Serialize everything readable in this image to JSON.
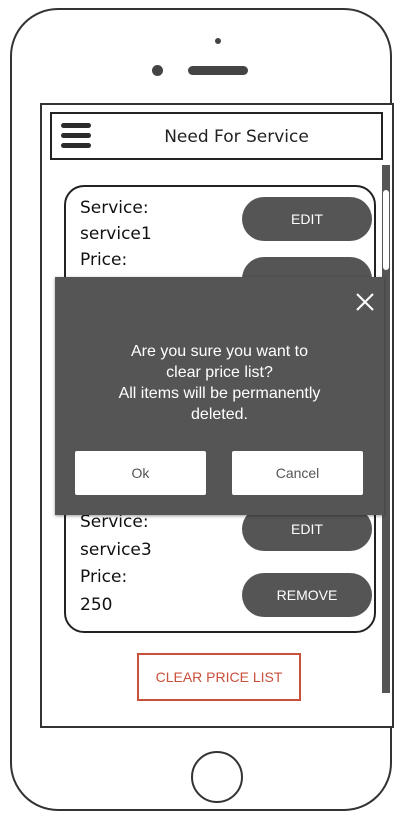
{
  "header": {
    "title": "Need For Service"
  },
  "cards": [
    {
      "service_label": "Service:",
      "service_value": "service1",
      "price_label": "Price:",
      "edit_label": "EDIT"
    },
    {
      "service_label": "Service:",
      "service_value": "service3",
      "price_label": "Price:",
      "price_value": "250",
      "edit_label": "EDIT",
      "remove_label": "REMOVE"
    }
  ],
  "clear_button": "CLEAR PRICE LIST",
  "dialog": {
    "message_line1": "Are you sure you want to",
    "message_line2": "clear price list?",
    "message_line3": "All items will be permanently",
    "message_line4": "deleted.",
    "ok_label": "Ok",
    "cancel_label": "Cancel"
  },
  "colors": {
    "dark_gray": "#555555",
    "accent_red": "#c9503a",
    "outline": "#222222"
  }
}
